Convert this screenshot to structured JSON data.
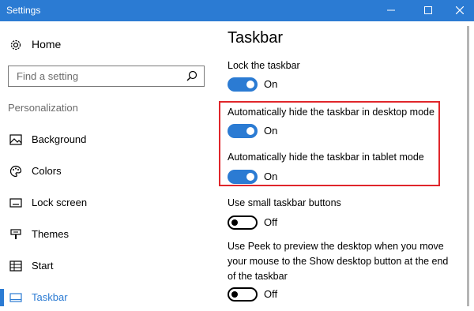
{
  "window": {
    "title": "Settings",
    "minimize_icon": "minimize-icon",
    "maximize_icon": "maximize-icon",
    "close_icon": "close-icon"
  },
  "colors": {
    "accent": "#2b7bd3",
    "highlight": "#e0262b"
  },
  "sidebar": {
    "home": {
      "label": "Home",
      "icon": "gear-icon"
    },
    "search": {
      "placeholder": "Find a setting",
      "icon": "search-icon"
    },
    "section": "Personalization",
    "items": [
      {
        "label": "Background",
        "icon": "picture-icon"
      },
      {
        "label": "Colors",
        "icon": "palette-icon"
      },
      {
        "label": "Lock screen",
        "icon": "lock-screen-icon"
      },
      {
        "label": "Themes",
        "icon": "brush-icon"
      },
      {
        "label": "Start",
        "icon": "start-icon"
      },
      {
        "label": "Taskbar",
        "icon": "taskbar-icon",
        "selected": true
      }
    ]
  },
  "main": {
    "title": "Taskbar",
    "settings": [
      {
        "label": "Lock the taskbar",
        "state": "On",
        "on": true
      },
      {
        "label": "Automatically hide the taskbar in desktop mode",
        "state": "On",
        "on": true
      },
      {
        "label": "Automatically hide the taskbar in tablet mode",
        "state": "On",
        "on": true
      },
      {
        "label": "Use small taskbar buttons",
        "state": "Off",
        "on": false
      },
      {
        "label": "Use Peek to preview the desktop when you move your mouse to the Show desktop button at the end of the taskbar",
        "state": "Off",
        "on": false
      }
    ]
  }
}
